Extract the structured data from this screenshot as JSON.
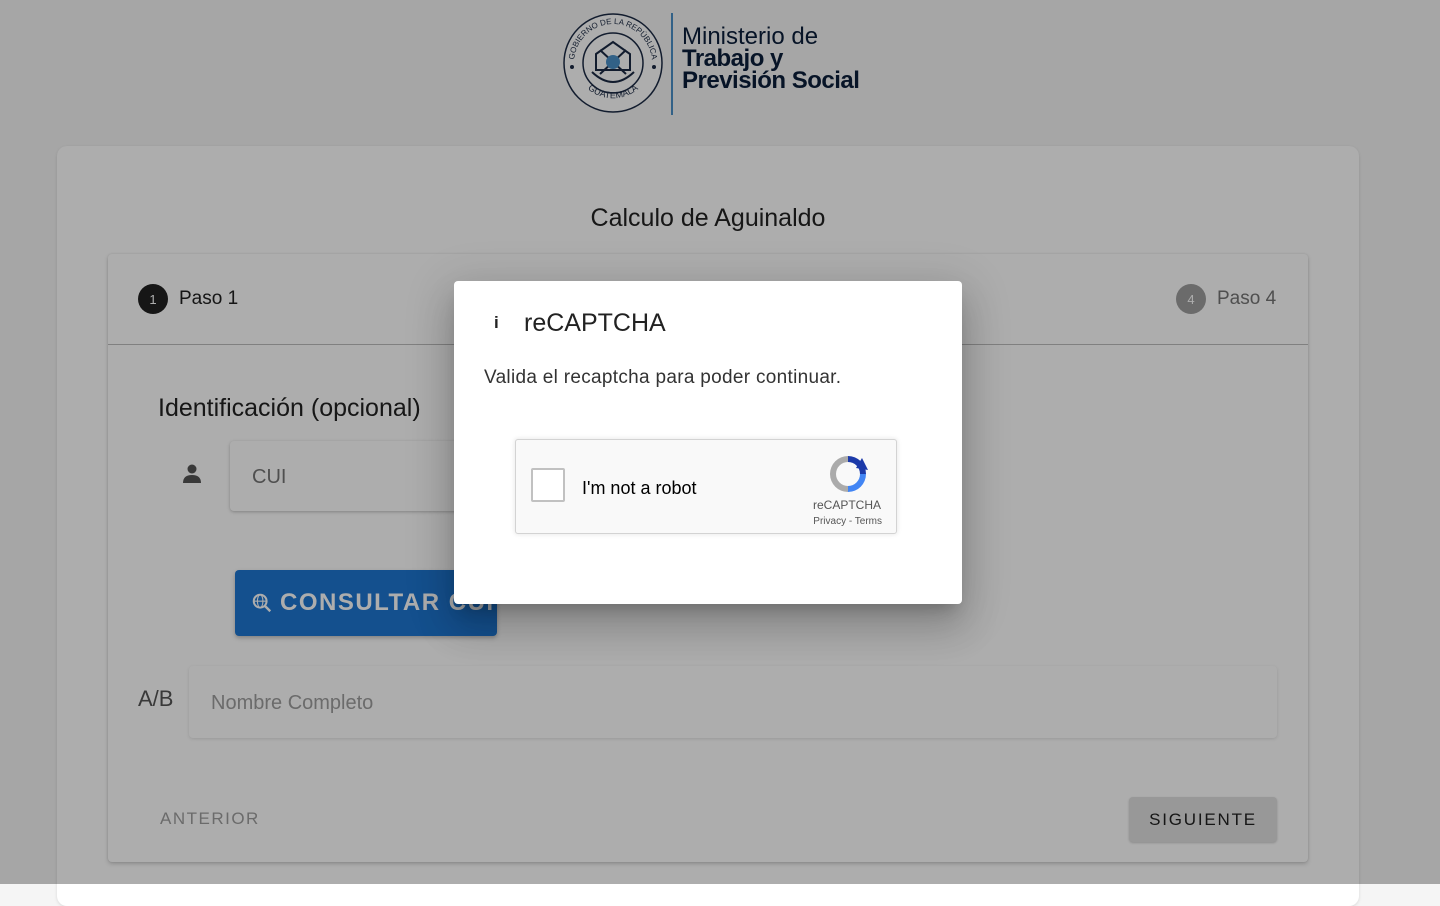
{
  "header": {
    "seal_text_top": "GOBIERNO DE LA REPÚBLICA",
    "seal_text_bottom": "GUATEMALA",
    "logo_line1": "Ministerio de",
    "logo_line2": "Trabajo y",
    "logo_line3": "Previsión Social"
  },
  "card": {
    "title": "Calculo de Aguinaldo"
  },
  "stepper": {
    "steps": [
      {
        "number": "1",
        "label": "Paso 1",
        "state": "active"
      },
      {
        "number": "4",
        "label": "Paso 4",
        "state": "inactive"
      }
    ]
  },
  "form": {
    "section_title": "Identificación (opcional)",
    "cui_placeholder": "CUI",
    "consult_button": "CONSULTAR CUI",
    "name_placeholder": "Nombre Completo",
    "ab_icon": "A/B",
    "prev_button": "ANTERIOR",
    "next_button": "SIGUIENTE"
  },
  "dialog": {
    "info_icon": "i",
    "title": "reCAPTCHA",
    "message": "Valida el recaptcha para poder continuar.",
    "recaptcha": {
      "label": "I'm not a robot",
      "brand": "reCAPTCHA",
      "links": "Privacy - Terms"
    }
  },
  "colors": {
    "primary_button": "#1e76d2",
    "overlay": "rgba(0,0,0,0.32)",
    "logo_text": "#0b1e3a"
  }
}
